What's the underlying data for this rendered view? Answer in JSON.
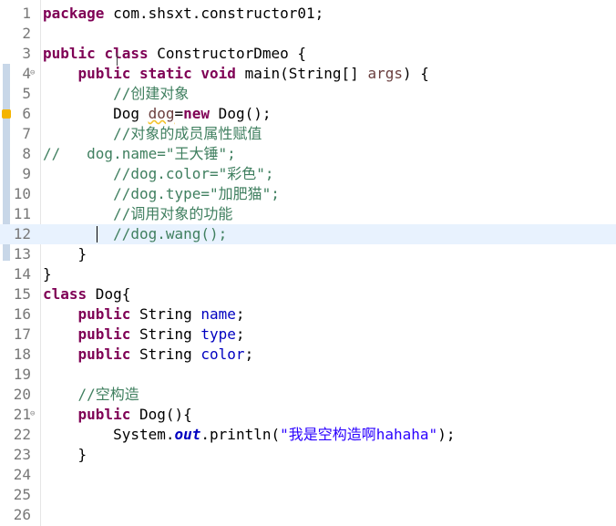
{
  "editor": {
    "lines": [
      {
        "n": "1"
      },
      {
        "n": "2"
      },
      {
        "n": "3"
      },
      {
        "n": "4"
      },
      {
        "n": "5"
      },
      {
        "n": "6"
      },
      {
        "n": "7"
      },
      {
        "n": "8"
      },
      {
        "n": "9"
      },
      {
        "n": "10"
      },
      {
        "n": "11"
      },
      {
        "n": "12"
      },
      {
        "n": "13"
      },
      {
        "n": "14"
      },
      {
        "n": "15"
      },
      {
        "n": "16"
      },
      {
        "n": "17"
      },
      {
        "n": "18"
      },
      {
        "n": "19"
      },
      {
        "n": "20"
      },
      {
        "n": "21"
      },
      {
        "n": "22"
      },
      {
        "n": "23"
      },
      {
        "n": "24"
      },
      {
        "n": "25"
      },
      {
        "n": "26"
      }
    ],
    "code": {
      "l1_kw": "package",
      "l1_rest": " com.shsxt.constructor01;",
      "l3_kw1": "public",
      "l3_kw2": "class",
      "l3_rest": " ConstructorDmeo {",
      "l4_kw1": "public",
      "l4_kw2": "static",
      "l4_kw3": "void",
      "l4_rest1": " main(String[] ",
      "l4_var": "args",
      "l4_rest2": ") {",
      "l5_cm": "//创建对象",
      "l6_a": "Dog ",
      "l6_var": "dog",
      "l6_b": "=",
      "l6_kw": "new",
      "l6_c": " Dog();",
      "l7_cm": "//对象的成员属性赋值",
      "l8_cm": "//   dog.name=\"王大锤\";",
      "l9_cm": "//dog.color=\"彩色\";",
      "l10_cm": "//dog.type=\"加肥猫\";",
      "l11_cm": "//调用对象的功能",
      "l12_cm": "//dog.wang();",
      "l13": "}",
      "l14": "}",
      "l15_kw": "class",
      "l15_rest": " Dog{",
      "l16_kw": "public",
      "l16_a": " String ",
      "l16_f": "name",
      "l16_b": ";",
      "l17_kw": "public",
      "l17_a": " String ",
      "l17_f": "type",
      "l17_b": ";",
      "l18_kw": "public",
      "l18_a": " String ",
      "l18_f": "color",
      "l18_b": ";",
      "l20_cm": "//空构造",
      "l21_kw": "public",
      "l21_rest": " Dog(){",
      "l22_a": "System.",
      "l22_st": "out",
      "l22_b": ".println(",
      "l22_str": "\"我是空构造啊hahaha\"",
      "l22_c": ");",
      "l23": "}"
    }
  },
  "colors": {
    "keyword": "#7f0055",
    "comment": "#3f7f5f",
    "string": "#2a00ff",
    "field": "#0000c0",
    "current_line": "#e8f2fe"
  },
  "icons": {
    "fold": "minus-fold-icon",
    "warning": "warning-marker-icon"
  }
}
